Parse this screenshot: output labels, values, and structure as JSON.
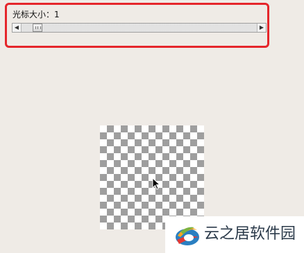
{
  "cursor_size": {
    "label": "光标大小：1",
    "slider_position": 0.05
  },
  "preview": {
    "cursor_icon": "arrow-cursor-icon"
  },
  "watermark": {
    "text": "云之居软件园",
    "logo_icon": "yunzhiju-logo-icon"
  },
  "colors": {
    "highlight": "#e5262b",
    "background": "#efebe6"
  }
}
